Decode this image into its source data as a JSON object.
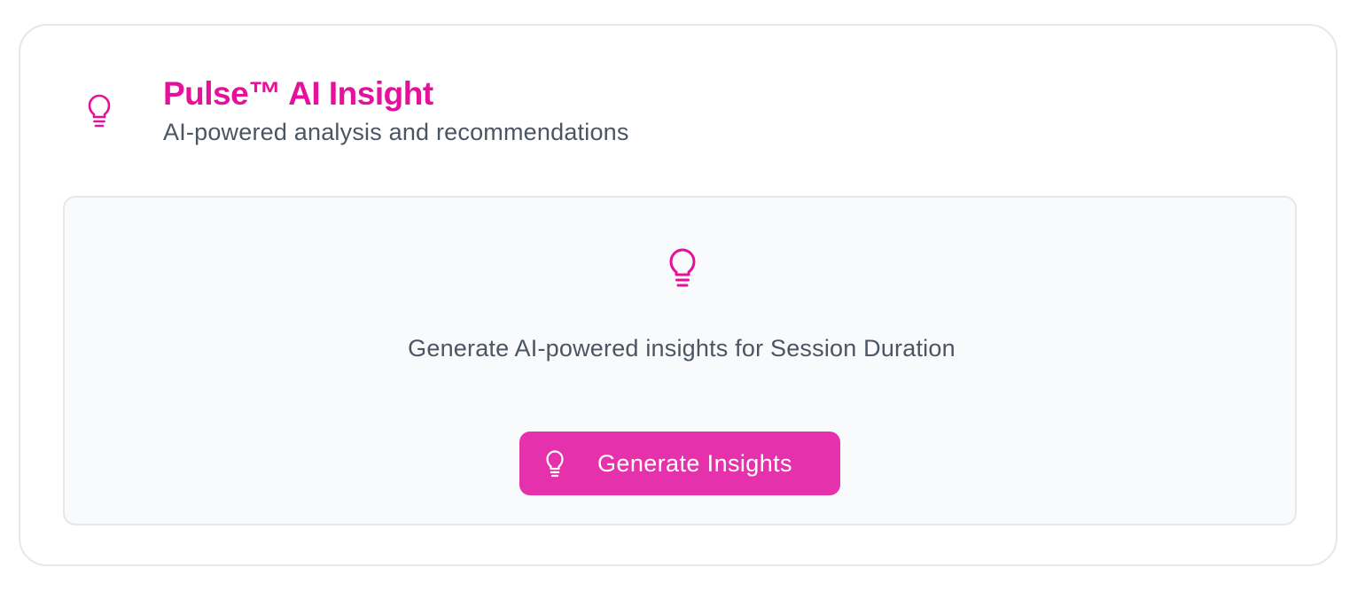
{
  "card": {
    "title": "Pulse™ AI Insight",
    "subtitle": "AI-powered analysis and recommendations",
    "header_icon": "lightbulb-icon"
  },
  "panel": {
    "icon": "lightbulb-icon",
    "message": "Generate AI-powered insights for Session Duration",
    "button": {
      "label": "Generate Insights",
      "icon": "lightbulb-icon"
    }
  },
  "colors": {
    "accent": "#e5119a",
    "button_bg": "#e531ab",
    "text_muted": "#4b5563",
    "border": "#e5e7eb",
    "panel_bg": "#f9fafb"
  }
}
